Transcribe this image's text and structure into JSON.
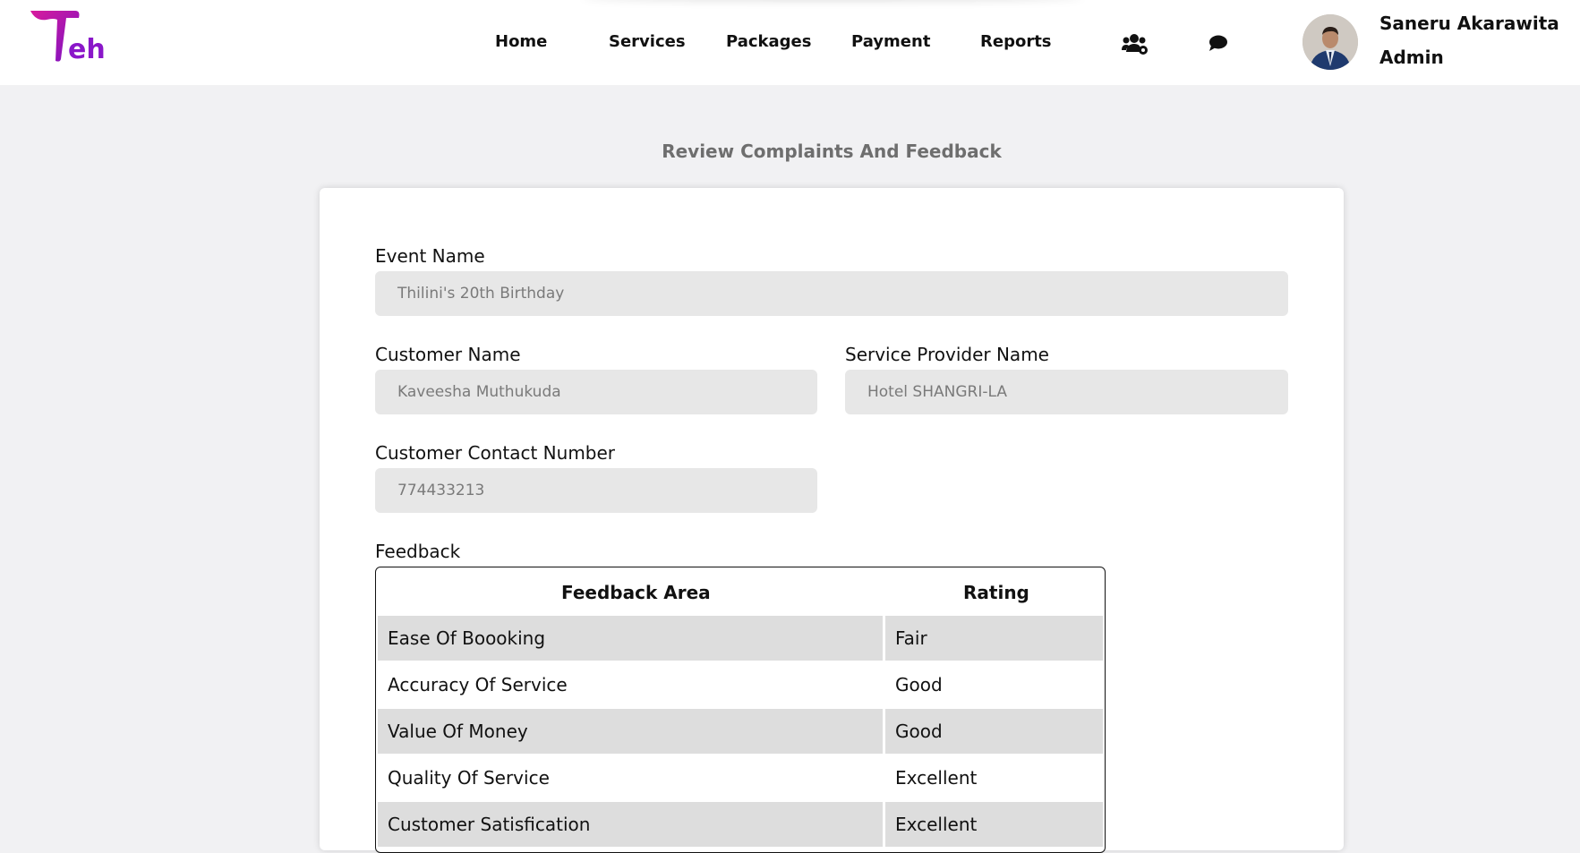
{
  "nav": {
    "links": [
      "Home",
      "Services",
      "Packages",
      "Payment",
      "Reports"
    ],
    "icons": [
      "users-settings-icon",
      "chat-bubble-icon"
    ]
  },
  "user": {
    "name": "Saneru Akarawita",
    "role": "Admin"
  },
  "brand": {
    "logo_text": "Teh",
    "colors": {
      "logo_primary": "#8a17c9",
      "logo_accent": "#d81b9c"
    }
  },
  "page": {
    "title": "Review Complaints And Feedback"
  },
  "form": {
    "event_name": {
      "label": "Event Name",
      "value": "Thilini's 20th Birthday"
    },
    "customer_name": {
      "label": "Customer Name",
      "value": "Kaveesha Muthukuda"
    },
    "service_provider_name": {
      "label": "Service Provider Name",
      "value": "Hotel SHANGRI-LA"
    },
    "customer_contact_number": {
      "label": "Customer Contact Number",
      "value": "774433213"
    }
  },
  "feedback": {
    "label": "Feedback",
    "headers": {
      "area": "Feedback Area",
      "rating": "Rating"
    },
    "rows": [
      {
        "area": "Ease Of Boooking",
        "rating": "Fair"
      },
      {
        "area": "Accuracy Of Service",
        "rating": "Good"
      },
      {
        "area": "Value Of Money",
        "rating": "Good"
      },
      {
        "area": "Quality Of Service",
        "rating": "Excellent"
      },
      {
        "area": "Customer Satisfication",
        "rating": "Excellent"
      }
    ]
  }
}
